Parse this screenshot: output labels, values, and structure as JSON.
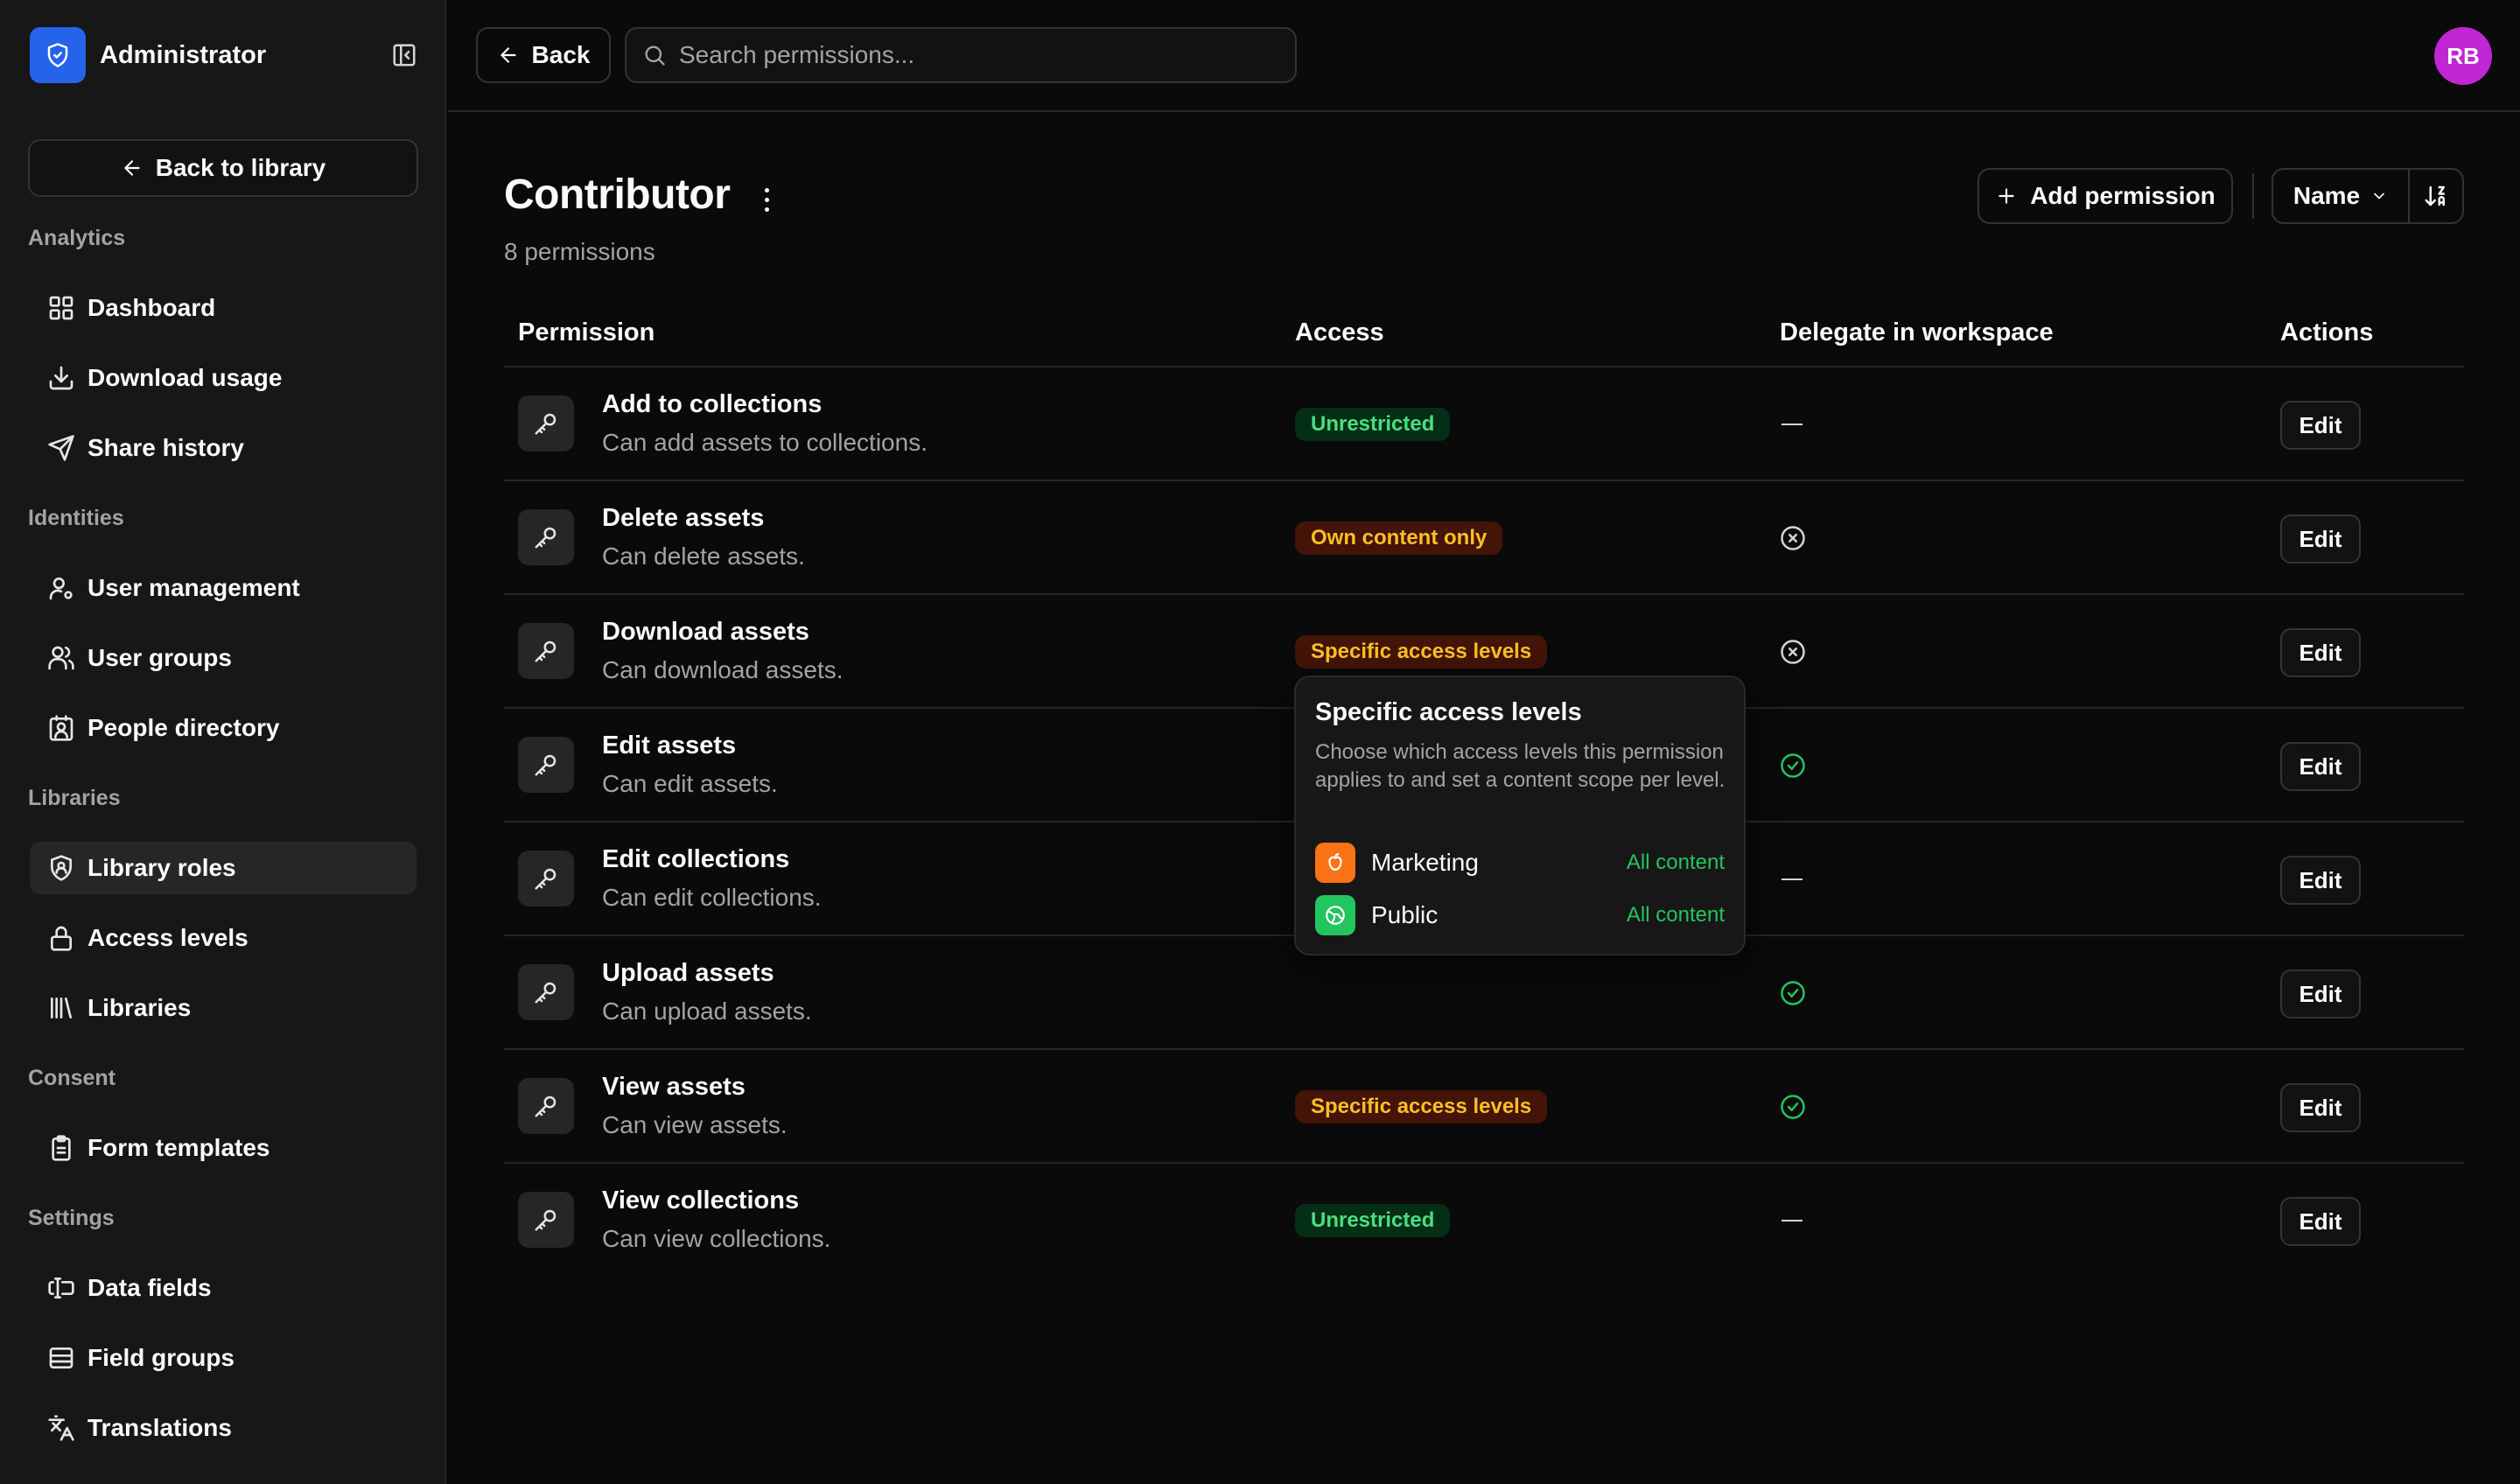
{
  "sidebar": {
    "title": "Administrator",
    "back_to_library": "Back to library",
    "sections": [
      {
        "label": "Analytics",
        "items": [
          {
            "label": "Dashboard",
            "icon": "dashboard-icon"
          },
          {
            "label": "Download usage",
            "icon": "download-icon"
          },
          {
            "label": "Share history",
            "icon": "send-icon"
          }
        ]
      },
      {
        "label": "Identities",
        "items": [
          {
            "label": "User management",
            "icon": "user-cog-icon"
          },
          {
            "label": "User groups",
            "icon": "users-icon"
          },
          {
            "label": "People directory",
            "icon": "contact-icon"
          }
        ]
      },
      {
        "label": "Libraries",
        "items": [
          {
            "label": "Library roles",
            "icon": "shield-user-icon",
            "active": true
          },
          {
            "label": "Access levels",
            "icon": "lock-icon"
          },
          {
            "label": "Libraries",
            "icon": "library-icon"
          }
        ]
      },
      {
        "label": "Consent",
        "items": [
          {
            "label": "Form templates",
            "icon": "clipboard-icon"
          }
        ]
      },
      {
        "label": "Settings",
        "items": [
          {
            "label": "Data fields",
            "icon": "text-cursor-input-icon"
          },
          {
            "label": "Field groups",
            "icon": "layers-icon"
          },
          {
            "label": "Translations",
            "icon": "languages-icon"
          }
        ]
      }
    ]
  },
  "topbar": {
    "back_label": "Back",
    "search_placeholder": "Search permissions...",
    "avatar_initials": "RB"
  },
  "page": {
    "title": "Contributor",
    "subtitle": "8 permissions",
    "add_permission": "Add permission",
    "sort_label": "Name"
  },
  "table": {
    "headers": [
      "Permission",
      "Access",
      "Delegate in workspace",
      "Actions"
    ],
    "rows": [
      {
        "title": "Add to collections",
        "desc": "Can add assets to collections.",
        "access": "Unrestricted",
        "access_color": "green",
        "delegate": "none",
        "action": "Edit"
      },
      {
        "title": "Delete assets",
        "desc": "Can delete assets.",
        "access": "Own content only",
        "access_color": "orange",
        "delegate": "no",
        "action": "Edit"
      },
      {
        "title": "Download assets",
        "desc": "Can download assets.",
        "access": "Specific access levels",
        "access_color": "orange",
        "delegate": "no",
        "action": "Edit"
      },
      {
        "title": "Edit assets",
        "desc": "Can edit assets.",
        "access": "",
        "access_color": "",
        "delegate": "yes",
        "action": "Edit"
      },
      {
        "title": "Edit collections",
        "desc": "Can edit collections.",
        "access": "",
        "access_color": "",
        "delegate": "none",
        "action": "Edit"
      },
      {
        "title": "Upload assets",
        "desc": "Can upload assets.",
        "access": "",
        "access_color": "",
        "delegate": "yes",
        "action": "Edit"
      },
      {
        "title": "View assets",
        "desc": "Can view assets.",
        "access": "Specific access levels",
        "access_color": "orange",
        "delegate": "yes",
        "action": "Edit"
      },
      {
        "title": "View collections",
        "desc": "Can view collections.",
        "access": "Unrestricted",
        "access_color": "green",
        "delegate": "none",
        "action": "Edit"
      }
    ]
  },
  "popover": {
    "title": "Specific access levels",
    "description": "Choose which access levels this permission applies to and set a content scope per level.",
    "levels": [
      {
        "name": "Marketing",
        "scope": "All content",
        "color": "#f97316",
        "icon": "apple-icon"
      },
      {
        "name": "Public",
        "scope": "All content",
        "color": "#22c55e",
        "icon": "globe-icon"
      }
    ]
  },
  "colors": {
    "brand": "#2563eb",
    "avatar": "#c026d3",
    "success": "#22c55e",
    "warning": "#fbbf24"
  }
}
